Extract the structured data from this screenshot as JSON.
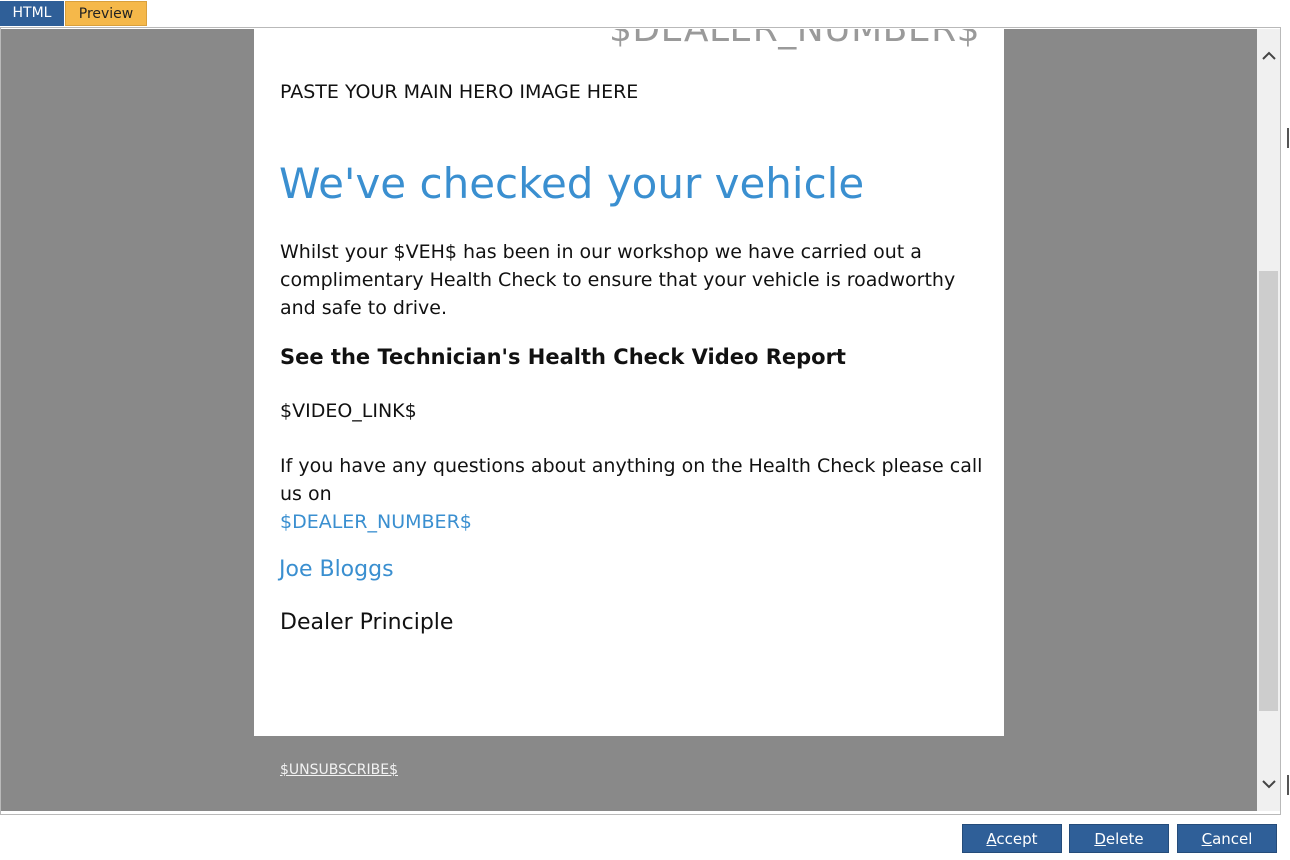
{
  "tabs": [
    {
      "label": "HTML",
      "active": false
    },
    {
      "label": "Preview",
      "active": true
    }
  ],
  "email": {
    "header_faded": "$DEALER_NUMBER$",
    "hero_placeholder": "PASTE YOUR MAIN HERO IMAGE HERE",
    "headline": "We've checked your vehicle",
    "intro": "Whilst your $VEH$ has been in our workshop we have carried out a complimentary Health Check to ensure that your vehicle is roadworthy and safe to drive.",
    "subheading": "See the Technician's Health Check Video Report",
    "video_link": "$VIDEO_LINK$",
    "questions_text": "If you have any questions about anything on the Health Check please call us on",
    "dealer_number": "$DEALER_NUMBER$",
    "signature_name": "Joe Bloggs",
    "signature_role": "Dealer Principle"
  },
  "footer": {
    "unsubscribe": "$UNSUBSCRIBE$"
  },
  "buttons": {
    "accept": {
      "first": "A",
      "rest": "ccept"
    },
    "delete": {
      "first": "D",
      "rest": "elete"
    },
    "cancel": {
      "first": "C",
      "rest": "ancel"
    }
  },
  "colors": {
    "tab_html": "#2f5f98",
    "tab_preview": "#f5b84a",
    "accent_blue": "#3a8fd0",
    "preview_background": "#898989",
    "button_blue": "#2f5f98"
  },
  "icons": {
    "scroll_up": "chevron-up-icon",
    "scroll_down": "chevron-down-icon"
  }
}
